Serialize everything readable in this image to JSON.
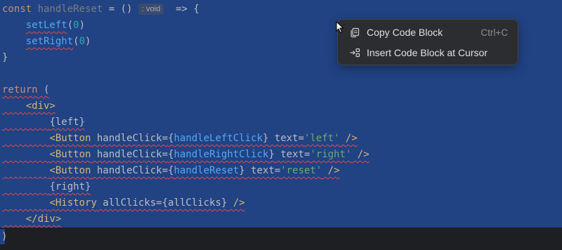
{
  "code": {
    "l1": {
      "kw": "const ",
      "name": "handleReset",
      "eq": " = ",
      "params": "()",
      "hint": ": void",
      "arrow": "  => {"
    },
    "l2": {
      "fn": "setLeft",
      "open": "(",
      "num": "0",
      "close": ")"
    },
    "l3": {
      "fn": "setRight",
      "open": "(",
      "num": "0",
      "close": ")"
    },
    "l4": {
      "text": "}"
    },
    "l6": {
      "kw": "return",
      "rest": " ("
    },
    "l7": {
      "tag": "<div>"
    },
    "l8": {
      "text": "{left}"
    },
    "l9": {
      "tag": "<Button",
      "attr": " handleClick=",
      "ob": "{",
      "fn": "handleLeftClick",
      "cb": "}",
      "attr2": " text=",
      "str": "'left'",
      "end": " />"
    },
    "l10": {
      "tag": "<Button",
      "attr": " handleClick=",
      "ob": "{",
      "fn": "handleRightClick",
      "cb": "}",
      "attr2": " text=",
      "str": "'right'",
      "end": " />"
    },
    "l11": {
      "tag": "<Button",
      "attr": " handleClick=",
      "ob": "{",
      "fn": "handleReset",
      "cb": "}",
      "attr2": " text=",
      "str": "'reset'",
      "end": " />"
    },
    "l12": {
      "text": "{right}"
    },
    "l13": {
      "tag": "<History",
      "attr": " allClicks=",
      "val": "{allClicks}",
      "end": " />"
    },
    "l14": {
      "tag": "</div>"
    },
    "l15": {
      "text": ")"
    }
  },
  "context_menu": {
    "items": [
      {
        "icon": "copy-icon",
        "label": "Copy Code Block",
        "shortcut": "Ctrl+C"
      },
      {
        "icon": "insert-at-cursor-icon",
        "label": "Insert Code Block at Cursor",
        "shortcut": ""
      }
    ]
  },
  "colors": {
    "selection": "#214283",
    "keyword": "#cf8e6d",
    "function": "#56a8f5",
    "tag": "#d5b778",
    "string": "#6aab73",
    "number": "#2aacb8",
    "error_wave": "#e5484d",
    "menu_bg": "#2b2d30"
  }
}
